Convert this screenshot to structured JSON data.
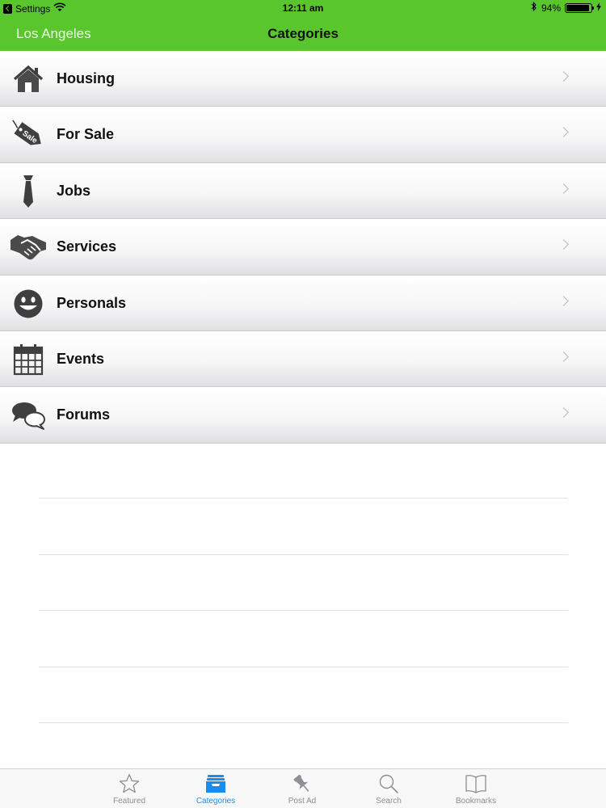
{
  "status_bar": {
    "back_app": "Settings",
    "time": "12:11 am",
    "battery": "94%",
    "battery_level": 0.94
  },
  "nav": {
    "left": "Los Angeles",
    "title": "Categories"
  },
  "categories": [
    {
      "label": "Housing",
      "icon": "house-icon"
    },
    {
      "label": "For Sale",
      "icon": "sale-tag-icon",
      "tag_text": "Sale"
    },
    {
      "label": "Jobs",
      "icon": "necktie-icon"
    },
    {
      "label": "Services",
      "icon": "handshake-icon"
    },
    {
      "label": "Personals",
      "icon": "smiley-icon"
    },
    {
      "label": "Events",
      "icon": "calendar-icon"
    },
    {
      "label": "Forums",
      "icon": "speech-bubbles-icon"
    }
  ],
  "tabs": [
    {
      "label": "Featured",
      "icon": "star-icon",
      "active": false
    },
    {
      "label": "Categories",
      "icon": "inbox-tray-icon",
      "active": true
    },
    {
      "label": "Post Ad",
      "icon": "pushpin-icon",
      "active": false
    },
    {
      "label": "Search",
      "icon": "magnifier-icon",
      "active": false
    },
    {
      "label": "Bookmarks",
      "icon": "book-icon",
      "active": false
    }
  ],
  "colors": {
    "nav_green": "#5ac62e",
    "tab_active": "#1a8cf0",
    "tab_inactive": "#8e8e93",
    "icon_gray": "#444444"
  }
}
